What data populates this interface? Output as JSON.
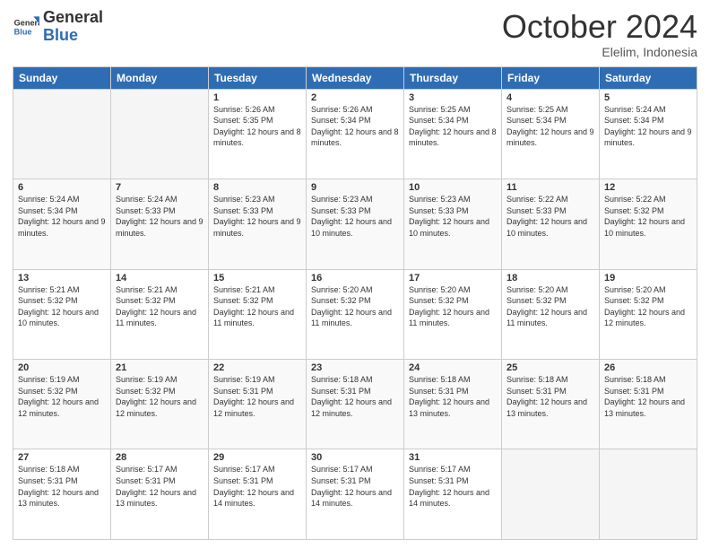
{
  "logo": {
    "line1": "General",
    "line2": "Blue"
  },
  "header": {
    "month": "October 2024",
    "location": "Elelim, Indonesia"
  },
  "weekdays": [
    "Sunday",
    "Monday",
    "Tuesday",
    "Wednesday",
    "Thursday",
    "Friday",
    "Saturday"
  ],
  "weeks": [
    [
      {
        "num": "",
        "sunrise": "",
        "sunset": "",
        "daylight": "",
        "empty": true
      },
      {
        "num": "",
        "sunrise": "",
        "sunset": "",
        "daylight": "",
        "empty": true
      },
      {
        "num": "1",
        "sunrise": "Sunrise: 5:26 AM",
        "sunset": "Sunset: 5:35 PM",
        "daylight": "Daylight: 12 hours and 8 minutes.",
        "empty": false
      },
      {
        "num": "2",
        "sunrise": "Sunrise: 5:26 AM",
        "sunset": "Sunset: 5:34 PM",
        "daylight": "Daylight: 12 hours and 8 minutes.",
        "empty": false
      },
      {
        "num": "3",
        "sunrise": "Sunrise: 5:25 AM",
        "sunset": "Sunset: 5:34 PM",
        "daylight": "Daylight: 12 hours and 8 minutes.",
        "empty": false
      },
      {
        "num": "4",
        "sunrise": "Sunrise: 5:25 AM",
        "sunset": "Sunset: 5:34 PM",
        "daylight": "Daylight: 12 hours and 9 minutes.",
        "empty": false
      },
      {
        "num": "5",
        "sunrise": "Sunrise: 5:24 AM",
        "sunset": "Sunset: 5:34 PM",
        "daylight": "Daylight: 12 hours and 9 minutes.",
        "empty": false
      }
    ],
    [
      {
        "num": "6",
        "sunrise": "Sunrise: 5:24 AM",
        "sunset": "Sunset: 5:34 PM",
        "daylight": "Daylight: 12 hours and 9 minutes.",
        "empty": false
      },
      {
        "num": "7",
        "sunrise": "Sunrise: 5:24 AM",
        "sunset": "Sunset: 5:33 PM",
        "daylight": "Daylight: 12 hours and 9 minutes.",
        "empty": false
      },
      {
        "num": "8",
        "sunrise": "Sunrise: 5:23 AM",
        "sunset": "Sunset: 5:33 PM",
        "daylight": "Daylight: 12 hours and 9 minutes.",
        "empty": false
      },
      {
        "num": "9",
        "sunrise": "Sunrise: 5:23 AM",
        "sunset": "Sunset: 5:33 PM",
        "daylight": "Daylight: 12 hours and 10 minutes.",
        "empty": false
      },
      {
        "num": "10",
        "sunrise": "Sunrise: 5:23 AM",
        "sunset": "Sunset: 5:33 PM",
        "daylight": "Daylight: 12 hours and 10 minutes.",
        "empty": false
      },
      {
        "num": "11",
        "sunrise": "Sunrise: 5:22 AM",
        "sunset": "Sunset: 5:33 PM",
        "daylight": "Daylight: 12 hours and 10 minutes.",
        "empty": false
      },
      {
        "num": "12",
        "sunrise": "Sunrise: 5:22 AM",
        "sunset": "Sunset: 5:32 PM",
        "daylight": "Daylight: 12 hours and 10 minutes.",
        "empty": false
      }
    ],
    [
      {
        "num": "13",
        "sunrise": "Sunrise: 5:21 AM",
        "sunset": "Sunset: 5:32 PM",
        "daylight": "Daylight: 12 hours and 10 minutes.",
        "empty": false
      },
      {
        "num": "14",
        "sunrise": "Sunrise: 5:21 AM",
        "sunset": "Sunset: 5:32 PM",
        "daylight": "Daylight: 12 hours and 11 minutes.",
        "empty": false
      },
      {
        "num": "15",
        "sunrise": "Sunrise: 5:21 AM",
        "sunset": "Sunset: 5:32 PM",
        "daylight": "Daylight: 12 hours and 11 minutes.",
        "empty": false
      },
      {
        "num": "16",
        "sunrise": "Sunrise: 5:20 AM",
        "sunset": "Sunset: 5:32 PM",
        "daylight": "Daylight: 12 hours and 11 minutes.",
        "empty": false
      },
      {
        "num": "17",
        "sunrise": "Sunrise: 5:20 AM",
        "sunset": "Sunset: 5:32 PM",
        "daylight": "Daylight: 12 hours and 11 minutes.",
        "empty": false
      },
      {
        "num": "18",
        "sunrise": "Sunrise: 5:20 AM",
        "sunset": "Sunset: 5:32 PM",
        "daylight": "Daylight: 12 hours and 11 minutes.",
        "empty": false
      },
      {
        "num": "19",
        "sunrise": "Sunrise: 5:20 AM",
        "sunset": "Sunset: 5:32 PM",
        "daylight": "Daylight: 12 hours and 12 minutes.",
        "empty": false
      }
    ],
    [
      {
        "num": "20",
        "sunrise": "Sunrise: 5:19 AM",
        "sunset": "Sunset: 5:32 PM",
        "daylight": "Daylight: 12 hours and 12 minutes.",
        "empty": false
      },
      {
        "num": "21",
        "sunrise": "Sunrise: 5:19 AM",
        "sunset": "Sunset: 5:32 PM",
        "daylight": "Daylight: 12 hours and 12 minutes.",
        "empty": false
      },
      {
        "num": "22",
        "sunrise": "Sunrise: 5:19 AM",
        "sunset": "Sunset: 5:31 PM",
        "daylight": "Daylight: 12 hours and 12 minutes.",
        "empty": false
      },
      {
        "num": "23",
        "sunrise": "Sunrise: 5:18 AM",
        "sunset": "Sunset: 5:31 PM",
        "daylight": "Daylight: 12 hours and 12 minutes.",
        "empty": false
      },
      {
        "num": "24",
        "sunrise": "Sunrise: 5:18 AM",
        "sunset": "Sunset: 5:31 PM",
        "daylight": "Daylight: 12 hours and 13 minutes.",
        "empty": false
      },
      {
        "num": "25",
        "sunrise": "Sunrise: 5:18 AM",
        "sunset": "Sunset: 5:31 PM",
        "daylight": "Daylight: 12 hours and 13 minutes.",
        "empty": false
      },
      {
        "num": "26",
        "sunrise": "Sunrise: 5:18 AM",
        "sunset": "Sunset: 5:31 PM",
        "daylight": "Daylight: 12 hours and 13 minutes.",
        "empty": false
      }
    ],
    [
      {
        "num": "27",
        "sunrise": "Sunrise: 5:18 AM",
        "sunset": "Sunset: 5:31 PM",
        "daylight": "Daylight: 12 hours and 13 minutes.",
        "empty": false
      },
      {
        "num": "28",
        "sunrise": "Sunrise: 5:17 AM",
        "sunset": "Sunset: 5:31 PM",
        "daylight": "Daylight: 12 hours and 13 minutes.",
        "empty": false
      },
      {
        "num": "29",
        "sunrise": "Sunrise: 5:17 AM",
        "sunset": "Sunset: 5:31 PM",
        "daylight": "Daylight: 12 hours and 14 minutes.",
        "empty": false
      },
      {
        "num": "30",
        "sunrise": "Sunrise: 5:17 AM",
        "sunset": "Sunset: 5:31 PM",
        "daylight": "Daylight: 12 hours and 14 minutes.",
        "empty": false
      },
      {
        "num": "31",
        "sunrise": "Sunrise: 5:17 AM",
        "sunset": "Sunset: 5:31 PM",
        "daylight": "Daylight: 12 hours and 14 minutes.",
        "empty": false
      },
      {
        "num": "",
        "sunrise": "",
        "sunset": "",
        "daylight": "",
        "empty": true
      },
      {
        "num": "",
        "sunrise": "",
        "sunset": "",
        "daylight": "",
        "empty": true
      }
    ]
  ]
}
